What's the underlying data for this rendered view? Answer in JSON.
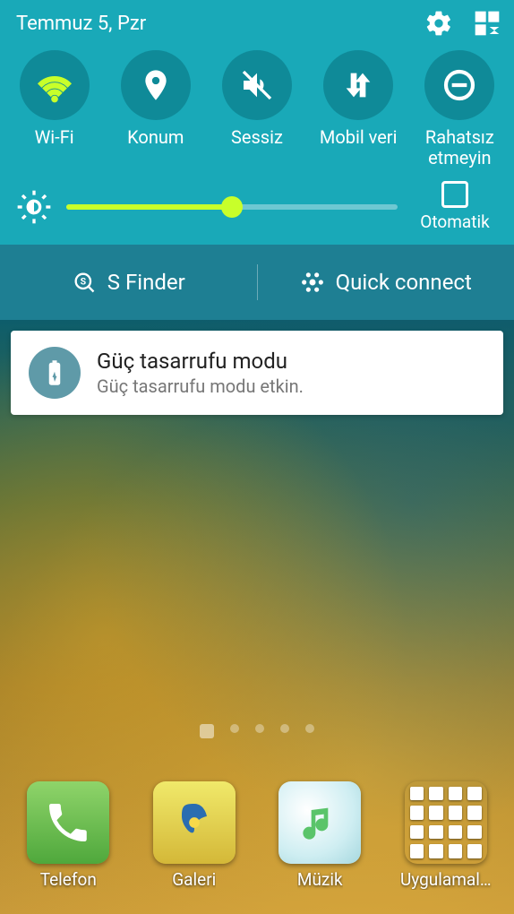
{
  "header": {
    "date": "Temmuz 5, Pzr"
  },
  "toggles": [
    {
      "label": "Wi-Fi",
      "icon": "wifi",
      "active": true
    },
    {
      "label": "Konum",
      "icon": "location",
      "active": false
    },
    {
      "label": "Sessiz",
      "icon": "mute",
      "active": false
    },
    {
      "label": "Mobil veri",
      "icon": "data",
      "active": false
    },
    {
      "label": "Rahatsız etmeyin",
      "icon": "dnd",
      "active": false
    }
  ],
  "brightness": {
    "percent": 50,
    "auto_label": "Otomatik",
    "auto_checked": false
  },
  "actions": {
    "sfinder": "S Finder",
    "quickconnect": "Quick connect"
  },
  "notification": {
    "title": "Güç tasarrufu modu",
    "subtitle": "Güç tasarrufu modu etkin."
  },
  "pager": {
    "count": 5,
    "home_index": 0,
    "active_index": 0
  },
  "dock": [
    {
      "label": "Telefon",
      "kind": "phone"
    },
    {
      "label": "Galeri",
      "kind": "gallery"
    },
    {
      "label": "Müzik",
      "kind": "music"
    },
    {
      "label": "Uygulamal…",
      "kind": "apps"
    }
  ]
}
